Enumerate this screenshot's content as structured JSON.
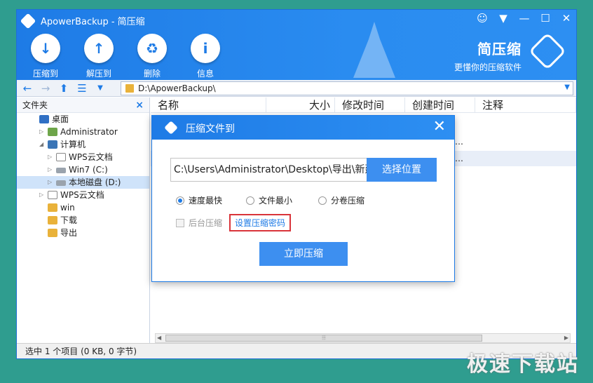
{
  "window": {
    "title": "ApowerBackup - 简压缩",
    "controls": [
      "☺",
      "▼",
      "—",
      "☐",
      "✕"
    ]
  },
  "toolbar": [
    {
      "label": "压缩到",
      "icon": "↓"
    },
    {
      "label": "解压到",
      "icon": "↑"
    },
    {
      "label": "删除",
      "icon": "♻"
    },
    {
      "label": "信息",
      "icon": "i"
    }
  ],
  "brand": {
    "name": "简压缩",
    "slogan": "更懂你的压缩软件"
  },
  "address": {
    "path": "D:\\ApowerBackup\\"
  },
  "left_panel": {
    "title": "文件夹",
    "close": "×",
    "tree": [
      {
        "label": "桌面",
        "level": 0,
        "icon": "desktop",
        "expander": ""
      },
      {
        "label": "Administrator",
        "level": 1,
        "icon": "user",
        "expander": "▷"
      },
      {
        "label": "计算机",
        "level": 1,
        "icon": "computer",
        "expander": "◢"
      },
      {
        "label": "WPS云文档",
        "level": 2,
        "icon": "doc",
        "expander": "▷"
      },
      {
        "label": "Win7 (C:)",
        "level": 2,
        "icon": "drive",
        "expander": "▷"
      },
      {
        "label": "本地磁盘 (D:)",
        "level": 2,
        "icon": "drive",
        "expander": "▷",
        "selected": true
      },
      {
        "label": "WPS云文档",
        "level": 1,
        "icon": "doc",
        "expander": "▷"
      },
      {
        "label": "win",
        "level": 1,
        "icon": "folder",
        "expander": ""
      },
      {
        "label": "下载",
        "level": 1,
        "icon": "folder",
        "expander": ""
      },
      {
        "label": "导出",
        "level": 1,
        "icon": "folder",
        "expander": ""
      }
    ]
  },
  "file_list": {
    "columns": [
      "名称",
      "大小",
      "修改时间",
      "创建时间",
      "注释"
    ],
    "row_fragments": [
      "…",
      "…"
    ]
  },
  "status": {
    "text": "选中 1 个项目 (0 KB, 0 字节)"
  },
  "dialog": {
    "title": "压缩文件到",
    "close": "✕",
    "path_value": "C:\\Users\\Administrator\\Desktop\\导出\\新建",
    "choose_label": "选择位置",
    "options": [
      {
        "label": "速度最快",
        "checked": true
      },
      {
        "label": "文件最小",
        "checked": false
      },
      {
        "label": "分卷压缩",
        "checked": false
      }
    ],
    "background_label": "后台压缩",
    "password_label": "设置压缩密码",
    "compress_label": "立即压缩"
  },
  "watermark": "极速下载站"
}
